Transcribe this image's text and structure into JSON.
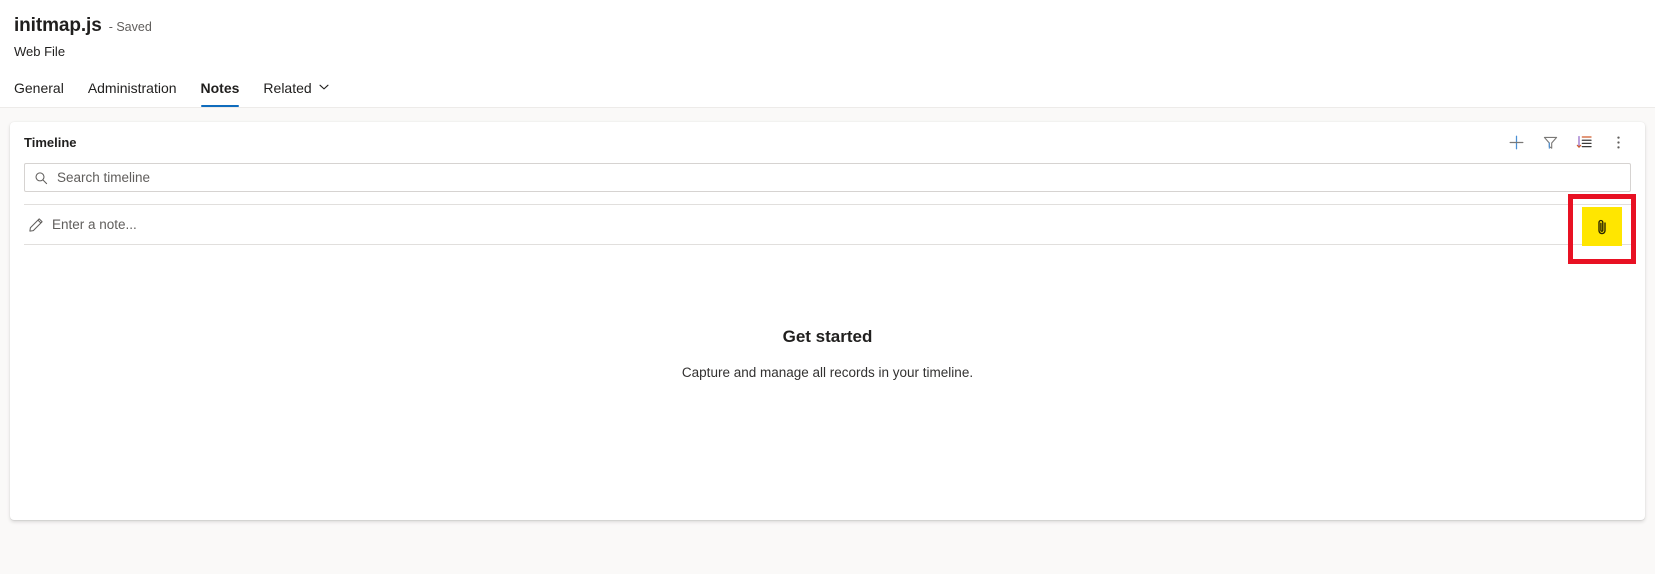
{
  "header": {
    "record_title": "initmap.js",
    "saved_state": "- Saved",
    "entity_type": "Web File"
  },
  "tabs": [
    {
      "label": "General",
      "active": false,
      "has_chevron": false
    },
    {
      "label": "Administration",
      "active": false,
      "has_chevron": false
    },
    {
      "label": "Notes",
      "active": true,
      "has_chevron": false
    },
    {
      "label": "Related",
      "active": false,
      "has_chevron": true
    }
  ],
  "timeline": {
    "panel_title": "Timeline",
    "actions": [
      {
        "name": "create-timeline-record-button",
        "icon": "plus-icon",
        "label": "Create a timeline record"
      },
      {
        "name": "filter-timeline-button",
        "icon": "filter-icon",
        "label": "Filter timeline"
      },
      {
        "name": "sort-timeline-button",
        "icon": "sort-descending-icon",
        "label": "Sort timeline"
      },
      {
        "name": "more-timeline-commands-button",
        "icon": "more-vertical-icon",
        "label": "More timeline commands"
      }
    ],
    "search": {
      "placeholder": "Search timeline",
      "value": "",
      "icon": "search-icon"
    },
    "note": {
      "placeholder": "Enter a note...",
      "value": "",
      "icon": "pencil-icon",
      "attach_icon": "paperclip-icon",
      "attach_label": "Add attachment"
    },
    "empty_state": {
      "title": "Get started",
      "subtitle": "Capture and manage all records in your timeline."
    }
  },
  "annotations": {
    "highlight_color": "#ffe600",
    "callout_color": "#e81123",
    "accent_color": "#0f6cbd"
  }
}
